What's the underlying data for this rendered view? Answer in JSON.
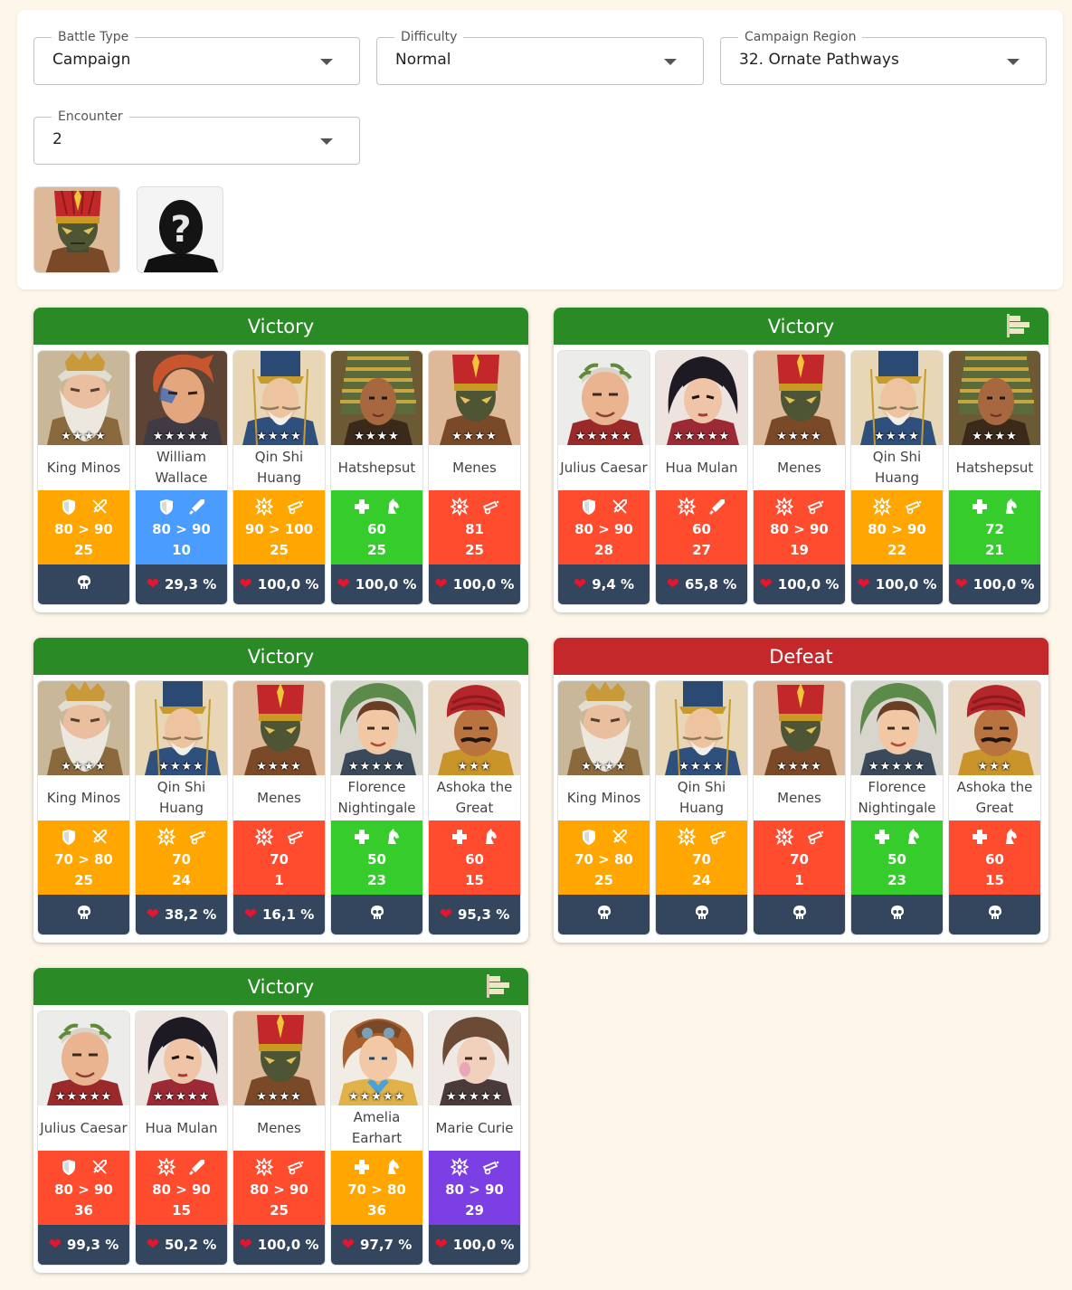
{
  "filters": {
    "battle_type": {
      "label": "Battle Type",
      "value": "Campaign"
    },
    "difficulty": {
      "label": "Difficulty",
      "value": "Normal"
    },
    "campaign_region": {
      "label": "Campaign Region",
      "value": "32. Ornate Pathways"
    },
    "encounter": {
      "label": "Encounter",
      "value": "2"
    }
  },
  "enemies": [
    {
      "name": "menes-enemy-portrait",
      "icon": "menes-portrait"
    },
    {
      "name": "unknown-enemy-portrait",
      "icon": "question-mark-silhouette"
    }
  ],
  "colors": {
    "victory": "#2a8a25",
    "defeat": "#c4282a",
    "orange": "#ffa600",
    "blue": "#4a9cff",
    "green": "#35cc2c",
    "red": "#ff4b2e",
    "purple": "#7b3fe4",
    "hp_bar": "#34465e"
  },
  "battles": [
    {
      "result": "Victory",
      "flag": false,
      "heroes": [
        {
          "name": "King Minos",
          "stars": "★★★★",
          "color": "orange",
          "icons": [
            "shield-icon",
            "no-sword-icon"
          ],
          "line1": "80 > 90",
          "line2": "25",
          "hp": "",
          "dead": true,
          "portrait": "minos"
        },
        {
          "name": "William Wallace",
          "stars": "★★★★★",
          "color": "blue",
          "icons": [
            "shield-icon",
            "sword-icon"
          ],
          "line1": "80 > 90",
          "line2": "10",
          "hp": "29,3 %",
          "dead": false,
          "portrait": "wallace"
        },
        {
          "name": "Qin Shi Huang",
          "stars": "★★★★",
          "color": "orange",
          "icons": [
            "burst-icon",
            "cannon-icon"
          ],
          "line1": "90 > 100",
          "line2": "25",
          "hp": "100,0 %",
          "dead": false,
          "portrait": "qin"
        },
        {
          "name": "Hatshepsut",
          "stars": "★★★★",
          "color": "green",
          "icons": [
            "cross-icon",
            "horse-icon"
          ],
          "line1": "60",
          "line2": "25",
          "hp": "100,0 %",
          "dead": false,
          "portrait": "hatshepsut"
        },
        {
          "name": "Menes",
          "stars": "★★★★",
          "color": "red",
          "icons": [
            "burst-icon",
            "cannon-icon"
          ],
          "line1": "81",
          "line2": "25",
          "hp": "100,0 %",
          "dead": false,
          "portrait": "menes"
        }
      ]
    },
    {
      "result": "Victory",
      "flag": true,
      "heroes": [
        {
          "name": "Julius Caesar",
          "stars": "★★★★★",
          "color": "red",
          "icons": [
            "shield-icon",
            "no-sword-icon"
          ],
          "line1": "80 > 90",
          "line2": "28",
          "hp": "9,4 %",
          "dead": false,
          "portrait": "caesar"
        },
        {
          "name": "Hua Mulan",
          "stars": "★★★★★",
          "color": "red",
          "icons": [
            "burst-icon",
            "sword-icon"
          ],
          "line1": "60",
          "line2": "27",
          "hp": "65,8 %",
          "dead": false,
          "portrait": "mulan"
        },
        {
          "name": "Menes",
          "stars": "★★★★",
          "color": "red",
          "icons": [
            "burst-icon",
            "cannon-icon"
          ],
          "line1": "80 > 90",
          "line2": "19",
          "hp": "100,0 %",
          "dead": false,
          "portrait": "menes"
        },
        {
          "name": "Qin Shi Huang",
          "stars": "★★★★",
          "color": "orange",
          "icons": [
            "burst-icon",
            "cannon-icon"
          ],
          "line1": "80 > 90",
          "line2": "22",
          "hp": "100,0 %",
          "dead": false,
          "portrait": "qin"
        },
        {
          "name": "Hatshepsut",
          "stars": "★★★★",
          "color": "green",
          "icons": [
            "cross-icon",
            "horse-icon"
          ],
          "line1": "72",
          "line2": "21",
          "hp": "100,0 %",
          "dead": false,
          "portrait": "hatshepsut"
        }
      ]
    },
    {
      "result": "Victory",
      "flag": false,
      "heroes": [
        {
          "name": "King Minos",
          "stars": "★★★★",
          "color": "orange",
          "icons": [
            "shield-icon",
            "no-sword-icon"
          ],
          "line1": "70 > 80",
          "line2": "25",
          "hp": "",
          "dead": true,
          "portrait": "minos"
        },
        {
          "name": "Qin Shi Huang",
          "stars": "★★★★",
          "color": "orange",
          "icons": [
            "burst-icon",
            "cannon-icon"
          ],
          "line1": "70",
          "line2": "24",
          "hp": "38,2 %",
          "dead": false,
          "portrait": "qin"
        },
        {
          "name": "Menes",
          "stars": "★★★★",
          "color": "red",
          "icons": [
            "burst-icon",
            "cannon-icon"
          ],
          "line1": "70",
          "line2": "1",
          "hp": "16,1 %",
          "dead": false,
          "portrait": "menes"
        },
        {
          "name": "Florence Nightingale",
          "stars": "★★★★★",
          "color": "green",
          "icons": [
            "cross-icon",
            "horse-icon"
          ],
          "line1": "50",
          "line2": "23",
          "hp": "",
          "dead": true,
          "portrait": "florence"
        },
        {
          "name": "Ashoka the Great",
          "stars": "★★★",
          "color": "red",
          "icons": [
            "cross-icon",
            "horse-icon"
          ],
          "line1": "60",
          "line2": "15",
          "hp": "95,3 %",
          "dead": false,
          "portrait": "ashoka"
        }
      ]
    },
    {
      "result": "Defeat",
      "flag": false,
      "heroes": [
        {
          "name": "King Minos",
          "stars": "★★★★",
          "color": "orange",
          "icons": [
            "shield-icon",
            "no-sword-icon"
          ],
          "line1": "70 > 80",
          "line2": "25",
          "hp": "",
          "dead": true,
          "portrait": "minos"
        },
        {
          "name": "Qin Shi Huang",
          "stars": "★★★★",
          "color": "orange",
          "icons": [
            "burst-icon",
            "cannon-icon"
          ],
          "line1": "70",
          "line2": "24",
          "hp": "",
          "dead": true,
          "portrait": "qin"
        },
        {
          "name": "Menes",
          "stars": "★★★★",
          "color": "red",
          "icons": [
            "burst-icon",
            "cannon-icon"
          ],
          "line1": "70",
          "line2": "1",
          "hp": "",
          "dead": true,
          "portrait": "menes"
        },
        {
          "name": "Florence Nightingale",
          "stars": "★★★★★",
          "color": "green",
          "icons": [
            "cross-icon",
            "horse-icon"
          ],
          "line1": "50",
          "line2": "23",
          "hp": "",
          "dead": true,
          "portrait": "florence"
        },
        {
          "name": "Ashoka the Great",
          "stars": "★★★",
          "color": "red",
          "icons": [
            "cross-icon",
            "horse-icon"
          ],
          "line1": "60",
          "line2": "15",
          "hp": "",
          "dead": true,
          "portrait": "ashoka"
        }
      ]
    },
    {
      "result": "Victory",
      "flag": true,
      "heroes": [
        {
          "name": "Julius Caesar",
          "stars": "★★★★★",
          "color": "red",
          "icons": [
            "shield-icon",
            "no-sword-icon"
          ],
          "line1": "80 > 90",
          "line2": "36",
          "hp": "99,3 %",
          "dead": false,
          "portrait": "caesar"
        },
        {
          "name": "Hua Mulan",
          "stars": "★★★★★",
          "color": "red",
          "icons": [
            "burst-icon",
            "sword-icon"
          ],
          "line1": "80 > 90",
          "line2": "15",
          "hp": "50,2 %",
          "dead": false,
          "portrait": "mulan"
        },
        {
          "name": "Menes",
          "stars": "★★★★",
          "color": "red",
          "icons": [
            "burst-icon",
            "cannon-icon"
          ],
          "line1": "80 > 90",
          "line2": "25",
          "hp": "100,0 %",
          "dead": false,
          "portrait": "menes"
        },
        {
          "name": "Amelia Earhart",
          "stars": "★★★★★",
          "color": "orange",
          "icons": [
            "cross-icon",
            "horse-icon"
          ],
          "line1": "70 > 80",
          "line2": "36",
          "hp": "97,7 %",
          "dead": false,
          "portrait": "amelia"
        },
        {
          "name": "Marie Curie",
          "stars": "★★★★★",
          "color": "purple",
          "icons": [
            "burst-icon",
            "cannon-icon"
          ],
          "line1": "80 > 90",
          "line2": "29",
          "hp": "100,0 %",
          "dead": false,
          "portrait": "curie"
        }
      ]
    }
  ]
}
